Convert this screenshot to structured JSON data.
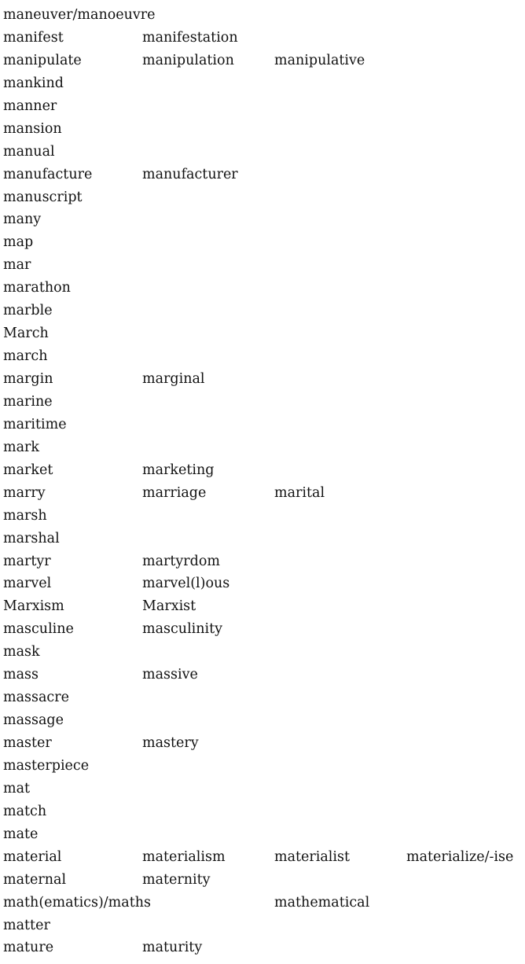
{
  "entries": [
    [
      "maneuver/manoeuvre"
    ],
    [
      "manifest",
      "manifestation"
    ],
    [
      "manipulate",
      "manipulation",
      "manipulative"
    ],
    [
      "mankind"
    ],
    [
      "manner"
    ],
    [
      "mansion"
    ],
    [
      "manual"
    ],
    [
      "manufacture",
      "manufacturer"
    ],
    [
      "manuscript"
    ],
    [
      "many"
    ],
    [
      "map"
    ],
    [
      "mar"
    ],
    [
      "marathon"
    ],
    [
      "marble"
    ],
    [
      "March"
    ],
    [
      "march"
    ],
    [
      "margin",
      "marginal"
    ],
    [
      "marine"
    ],
    [
      "maritime"
    ],
    [
      "mark"
    ],
    [
      "market",
      "marketing"
    ],
    [
      "marry",
      "marriage",
      "marital"
    ],
    [
      "marsh"
    ],
    [
      "marshal"
    ],
    [
      "martyr",
      "martyrdom"
    ],
    [
      "marvel",
      "marvel(l)ous"
    ],
    [
      "Marxism",
      "Marxist"
    ],
    [
      "masculine",
      "masculinity"
    ],
    [
      "mask"
    ],
    [
      "mass",
      "massive"
    ],
    [
      "massacre"
    ],
    [
      "massage"
    ],
    [
      "master",
      "mastery"
    ],
    [
      "masterpiece"
    ],
    [
      "mat"
    ],
    [
      "match"
    ],
    [
      "mate"
    ],
    [
      "material",
      "materialism",
      "materialist",
      "materialize/-ise"
    ],
    [
      "maternal",
      "maternity"
    ],
    [
      "math(ematics)/maths",
      "",
      "mathematical"
    ],
    [
      "matter"
    ],
    [
      "mature",
      "maturity"
    ]
  ]
}
